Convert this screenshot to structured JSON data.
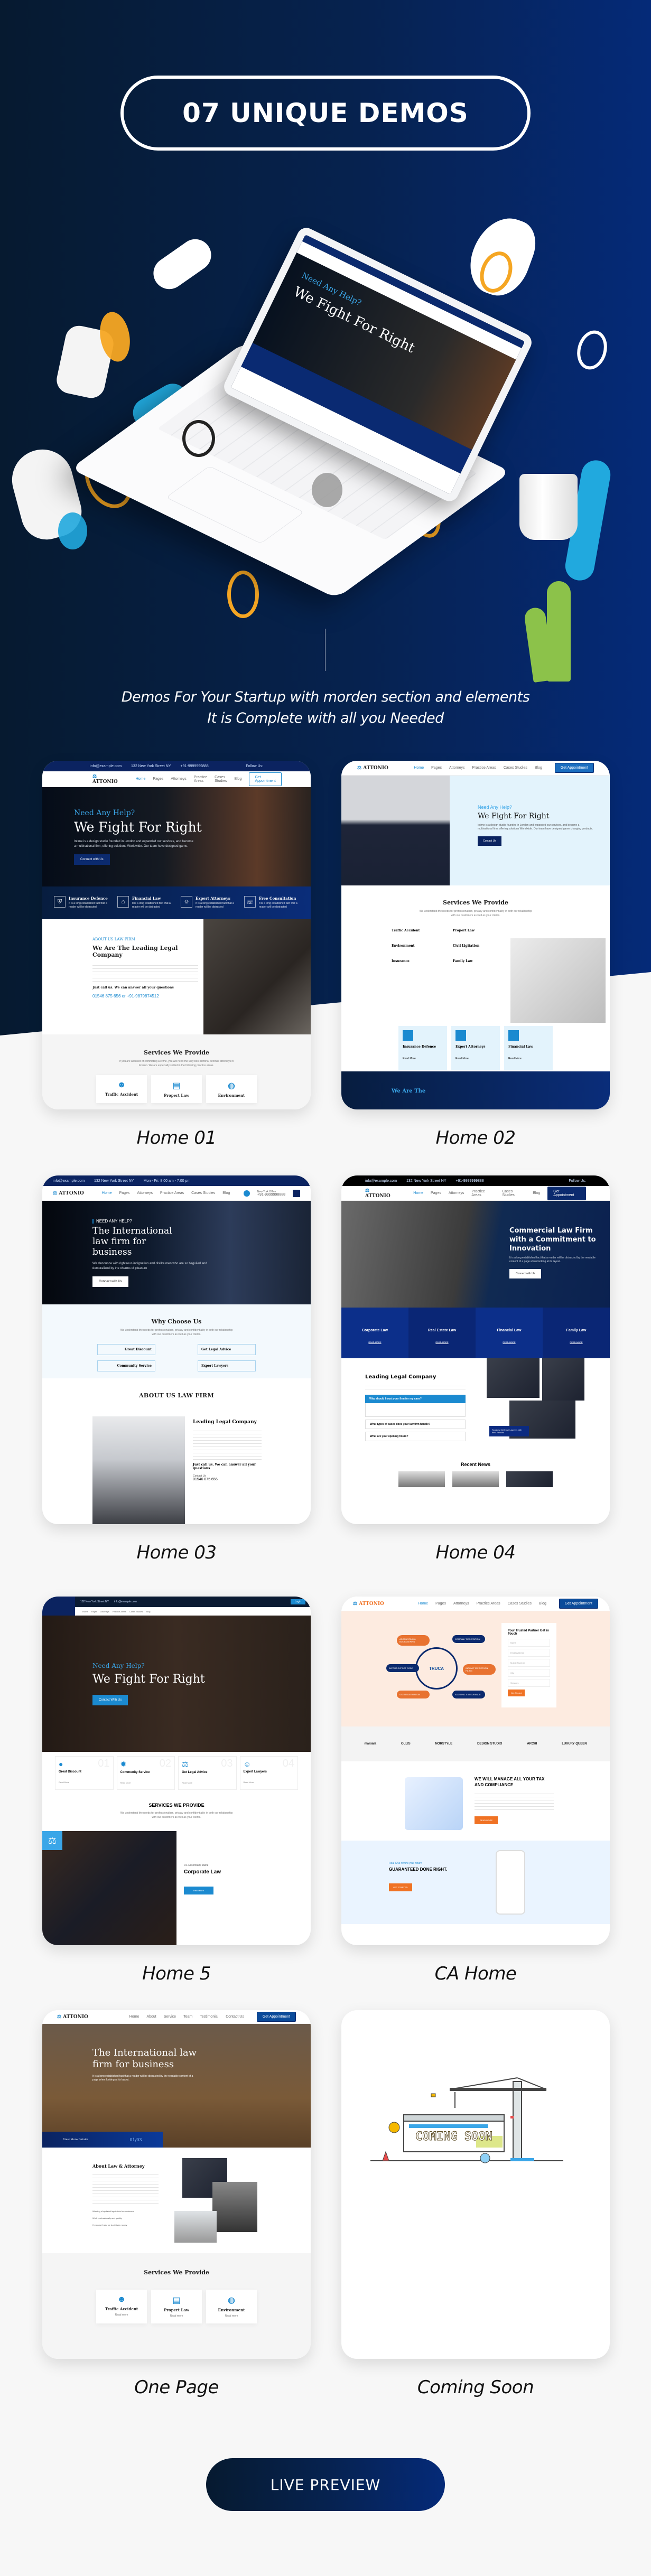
{
  "header": {
    "title": "07 UNIQUE DEMOS",
    "tagline_line1": "Demos For Your Startup with morden section and elements",
    "tagline_line2": "It is Complete with all you Needed"
  },
  "hero_laptop": {
    "screen_kicker": "Need Any Help?",
    "screen_title": "We Fight For Right"
  },
  "colors": {
    "navy_dark": "#061a30",
    "navy_blue": "#052a78",
    "accent_blue": "#1b8ad0",
    "accent_orange": "#f5a623",
    "page_bg": "#f7f7f7"
  },
  "demos": [
    {
      "label": "Home 01",
      "topbar": [
        "info@example.com",
        "132 New York Street NY",
        "+91-9999999888",
        "Follow Us:"
      ],
      "logo": "ATTONIO",
      "nav": [
        "Home",
        "Pages",
        "Attorneys",
        "Practice Areas",
        "Cases Studies",
        "Blog"
      ],
      "nav_button": "Get Appointment",
      "kicker": "Need Any Help?",
      "title": "We Fight For Right",
      "paragraph": "Intime is a design studio founded in London and expanded our services, and become a multinational firm, offering solutions Worldwide. Our team have designed game.",
      "cta": "Connect with Us",
      "features": [
        {
          "title": "Insurance Defence",
          "desc": "It is a long established fact that a reader will be distracted"
        },
        {
          "title": "Financial Law",
          "desc": "It is a long established fact that a reader will be distracted"
        },
        {
          "title": "Expert Attorneys",
          "desc": "It is a long established fact that a reader will be distracted"
        },
        {
          "title": "Free Consultation",
          "desc": "It is a long established fact that a reader will be distracted"
        }
      ],
      "about_kicker": "ABOUT US LAW FIRM",
      "about_title": "We Are The Leading Legal Company",
      "about_call": "Just call us. We can answer all your questions",
      "about_phone": "01546 875 656 or +91-9879874512",
      "services_title": "Services We Provide",
      "services_sub": "If you are accused of committing a crime, you will need the very best criminal defense attorneys in Fresno. We are especially skilled in the following practice areas.",
      "services": [
        "Traffic Accident",
        "Propert Law",
        "Environment"
      ]
    },
    {
      "label": "Home 02",
      "logo": "ATTONIO",
      "nav": [
        "Home",
        "Pages",
        "Attorneys",
        "Practice Areas",
        "Cases Studies",
        "Blog"
      ],
      "nav_button": "Get Appointment",
      "kicker": "Need Any Help?",
      "title": "We Fight For Right",
      "paragraph": "Intime is a design studio founded in London and expanded our services, and become a multinational firm, offering solutions Worldwide. Our team have designed game changing products.",
      "cta": "Contact Us",
      "services_title": "Services We Provide",
      "services_sub": "We understand the needs for professionalism, privacy and confidentiality in both our relationship with our customers as well as your clients.",
      "services": [
        "Traffic Accident",
        "Propert Law",
        "Environment",
        "Civil Ligitation",
        "Insurance",
        "Family Law"
      ],
      "cards": [
        {
          "title": "Insurance Defence",
          "link": "Read More"
        },
        {
          "title": "Expert Attorneys",
          "link": "Read More"
        },
        {
          "title": "Financial Law",
          "link": "Read More"
        }
      ],
      "band_title": "We Are The"
    },
    {
      "label": "Home 03",
      "topbar": [
        "info@example.com",
        "132 New York Street NY",
        "Mon - Fri: 8:00 am - 7:00 pm"
      ],
      "logo": "ATTONIO",
      "nav": [
        "Home",
        "Pages",
        "Attorneys",
        "Practice Areas",
        "Cases Studies",
        "Blog"
      ],
      "office_label": "New York Office",
      "office_phone": "+91-9999998888",
      "kicker": "NEED ANY HELP?",
      "title": "The International law firm for business",
      "paragraph": "We denounce with righteous indignation and dislike men who are so beguiled and demoralized by the charms of pleasure",
      "cta": "Connect with Us",
      "why_title": "Why Choose Us",
      "why_sub": "We understand the needs for professionalism, privacy and confidentiality in both our relationship with our customers as well as your clients.",
      "why_items": [
        "Great Discount",
        "Get Legal Advice",
        "Community Service",
        "Expert Lawyers"
      ],
      "about_title": "ABOUT US LAW FIRM",
      "about_heading": "Leading Legal Company",
      "about_call": "Just call us. We can answer all your questions",
      "contact_label": "Contact Us",
      "contact_phone": "01546 875 656"
    },
    {
      "label": "Home 04",
      "topbar": [
        "info@example.com",
        "132 New York Street NY",
        "+91-9999999888",
        "Follow Us:"
      ],
      "logo": "ATTONIO",
      "nav": [
        "Home",
        "Pages",
        "Attorneys",
        "Practice Areas",
        "Cases Studies",
        "Blog"
      ],
      "nav_button": "Get Appointment",
      "title": "Commercial Law Firm with a Commitment to Innovation",
      "paragraph": "It is a long established fact that a reader will be distracted by the readable content of a page when looking at its layout.",
      "cta": "Connect with Us",
      "features": [
        {
          "title": "Corporate Law",
          "link": "READ MORE"
        },
        {
          "title": "Real Estate Law",
          "link": "READ MORE"
        },
        {
          "title": "Financial Law",
          "link": "READ MORE"
        },
        {
          "title": "Family Law",
          "link": "READ MORE"
        }
      ],
      "about_heading": "Leading Legal Company",
      "faq": [
        "Why should I trust your firm for my case?",
        "What types of cases does your law firm handle?",
        "What are your opening hours?"
      ],
      "badge": "Toughest Defense Lawyers with Best Results",
      "news_title": "Recent News"
    },
    {
      "label": "Home 5",
      "topbar": [
        "132 New York Street NY",
        "info@example.com"
      ],
      "login": "Login",
      "nav": [
        "Home",
        "Pages",
        "Attorneys",
        "Practice Areas",
        "Cases Studies",
        "Blog"
      ],
      "kicker": "Need Any Help?",
      "title": "We Fight For Right",
      "cta": "Contact With Us",
      "features": [
        {
          "num": "01",
          "title": "Great Discount",
          "link": "Read More"
        },
        {
          "num": "02",
          "title": "Community Service",
          "link": "Read More"
        },
        {
          "num": "03",
          "title": "Get Legal Advice",
          "link": "Read More"
        },
        {
          "num": "04",
          "title": "Expert Lawyers",
          "link": "Read More"
        }
      ],
      "services_title": "SERVICES WE PROVIDE",
      "services_sub": "We understand the needs for professionalism, privacy and confidentiality in both our relationship with our customers as well as your clients.",
      "service_kicker": "01. Essentially lawful",
      "service_title": "Corporate Law",
      "service_cta": "Read More"
    },
    {
      "label": "CA Home",
      "logo": "ATTONIO",
      "nav": [
        "Home",
        "Pages",
        "Attorneys",
        "Practice Areas",
        "Cases Studies",
        "Blog"
      ],
      "nav_button": "Get Appointment",
      "diagram_center": "TRUCA",
      "diagram_items": [
        "ACCOUNTING & BOOKKEEPING",
        "COMPANY REGISTATION",
        "IMPORT-EXPORT CODE",
        "INCOME TAX RETURN FILING",
        "GST REGISTRATION",
        "AUDITING & ASSURANCE"
      ],
      "form_title": "Your Trusted Partner Get in Touch",
      "form_fields": [
        "Name",
        "Email Address",
        "Mobile Number",
        "City",
        "Services"
      ],
      "form_button": "Get Started",
      "brands": [
        "marsala",
        "OLLIS",
        "NORSTYLE",
        "DESIGN STUDIO",
        "ARCHI",
        "LUXURY QUEEN"
      ],
      "tax_title": "WE WILL MANAGE ALL YOUR TAX AND COMPLIANCE",
      "tax_cta": "READ MORE",
      "guarantee_kicker": "Real CAs review your return",
      "guarantee_title": "GUARANTEED DONE RIGHT.",
      "guarantee_cta": "GET STARTED"
    },
    {
      "label": "One Page",
      "logo": "ATTONIO",
      "nav": [
        "Home",
        "About",
        "Service",
        "Team",
        "Testimonial",
        "Contact Us"
      ],
      "nav_button": "Get Appointment",
      "title": "The International law firm for business",
      "paragraph": "It is a long established fact that a reader will be distracted by the readable content of a page when looking at its layout.",
      "view_more": "View More Details",
      "slide_counter": "01/03",
      "about_title": "About Law & Attorney",
      "about_points": [
        "Warning of updated legal risks for customers",
        "Work professionally and quickly",
        "If you don't win, we don't take money."
      ],
      "services_title": "Services We Provide",
      "services": [
        "Traffic Accident",
        "Propert Law",
        "Environment"
      ],
      "service_link": "Read more"
    },
    {
      "label": "Coming Soon",
      "illustration_text": "COMING SOON"
    }
  ],
  "footer": {
    "live_preview": "LIVE PREVIEW"
  }
}
